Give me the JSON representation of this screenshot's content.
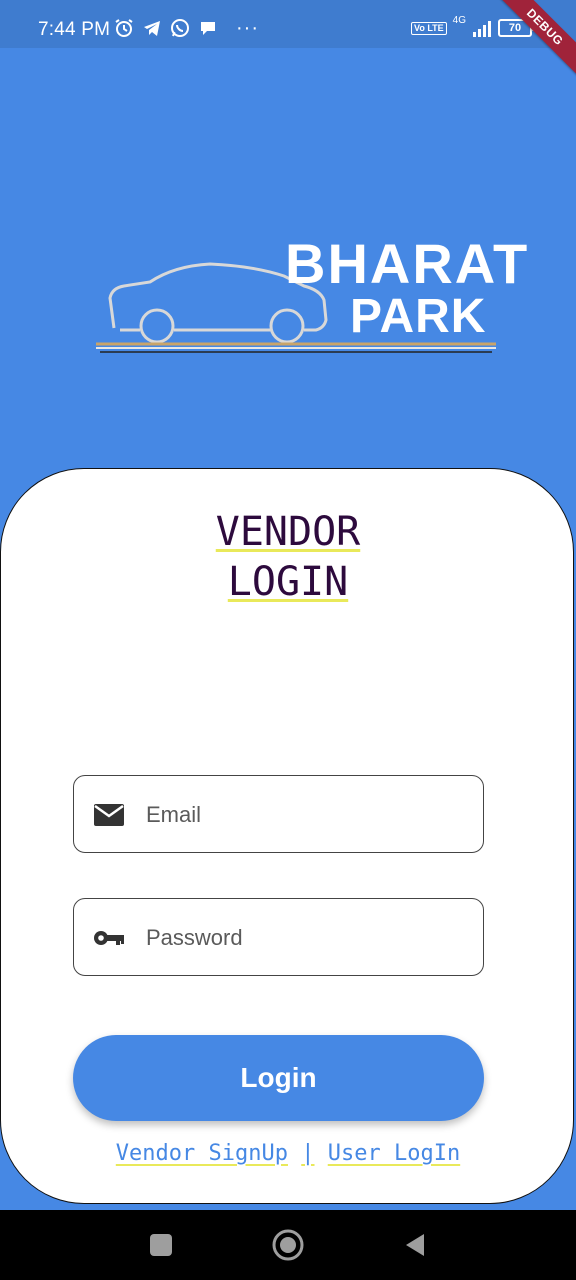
{
  "status_bar": {
    "time": "7:44 PM",
    "left_icons": [
      "alarm-icon",
      "telegram-icon",
      "whatsapp-icon",
      "chat-bubble-icon"
    ],
    "more": "···",
    "volte": "Vo LTE",
    "network": "4G",
    "battery": "70"
  },
  "debug_banner": "DEBUG",
  "logo": {
    "line1": "BHARAT",
    "line2": "PARK"
  },
  "card": {
    "title_line1": "VENDOR",
    "title_line2": "LOGIN",
    "email": {
      "placeholder": "Email",
      "value": "",
      "icon": "mail-icon"
    },
    "password": {
      "placeholder": "Password",
      "value": "",
      "icon": "key-icon"
    },
    "login_label": "Login",
    "links": {
      "vendor_signup": "Vendor SignUp",
      "separator": "|",
      "user_login": "User LogIn"
    }
  },
  "colors": {
    "background": "#4688E4",
    "status_bar": "#3F7CCF",
    "title": "#2D0A3D",
    "underline": "#E9E95A",
    "debug": "#A0233A"
  }
}
